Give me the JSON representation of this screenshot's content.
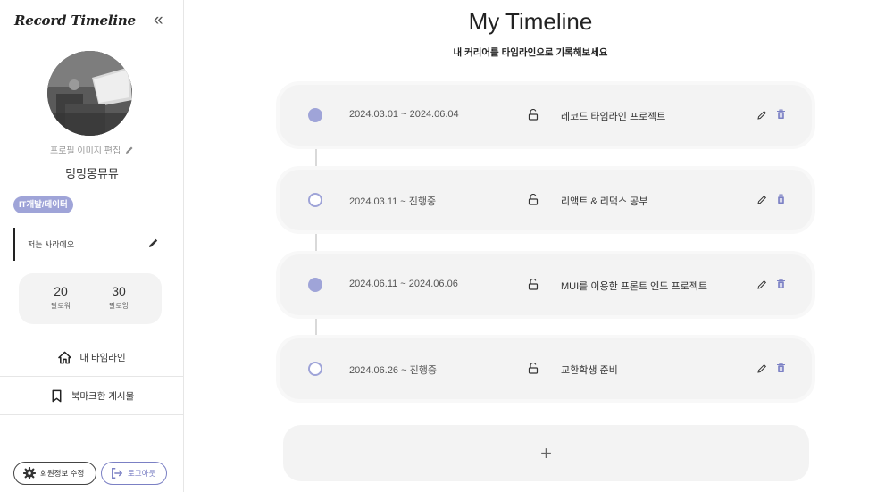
{
  "app": {
    "logo": "Record Timeline",
    "collapse_icon": "«"
  },
  "profile": {
    "edit_photo_label": "프로필 이미지 편집",
    "username": "밍밍몽뮤뮤",
    "tag": "IT개발/데이터",
    "bio": "저는 사라에오",
    "followers": {
      "count": "20",
      "label": "팔로워"
    },
    "following": {
      "count": "30",
      "label": "팔로잉"
    }
  },
  "nav": {
    "items": [
      {
        "label": "내 타임라인",
        "icon": "home-icon"
      },
      {
        "label": "북마크한 게시물",
        "icon": "bookmark-icon"
      }
    ]
  },
  "footer": {
    "edit_account_label": "회원정보 수정",
    "logout_label": "로그아웃"
  },
  "main": {
    "title": "My Timeline",
    "subtitle": "내 커리어를 타임라인으로 기록해보세요",
    "add_label": "+"
  },
  "timeline": [
    {
      "date": "2024.03.01 ~ 2024.06.04",
      "title": "레코드 타임라인 프로젝트",
      "status": "completed"
    },
    {
      "date": "2024.03.11 ~ 진행중",
      "title": "리액트 & 리덕스 공부",
      "status": "in-progress"
    },
    {
      "date": "2024.06.11 ~ 2024.06.06",
      "title": "MUI를 이용한 프론트 엔드 프로젝트",
      "status": "completed"
    },
    {
      "date": "2024.06.26 ~ 진행중",
      "title": "교환학생 준비",
      "status": "in-progress"
    }
  ],
  "colors": {
    "accent": "#9fa4d8",
    "card_bg": "#f3f3f3",
    "text": "#222222"
  }
}
